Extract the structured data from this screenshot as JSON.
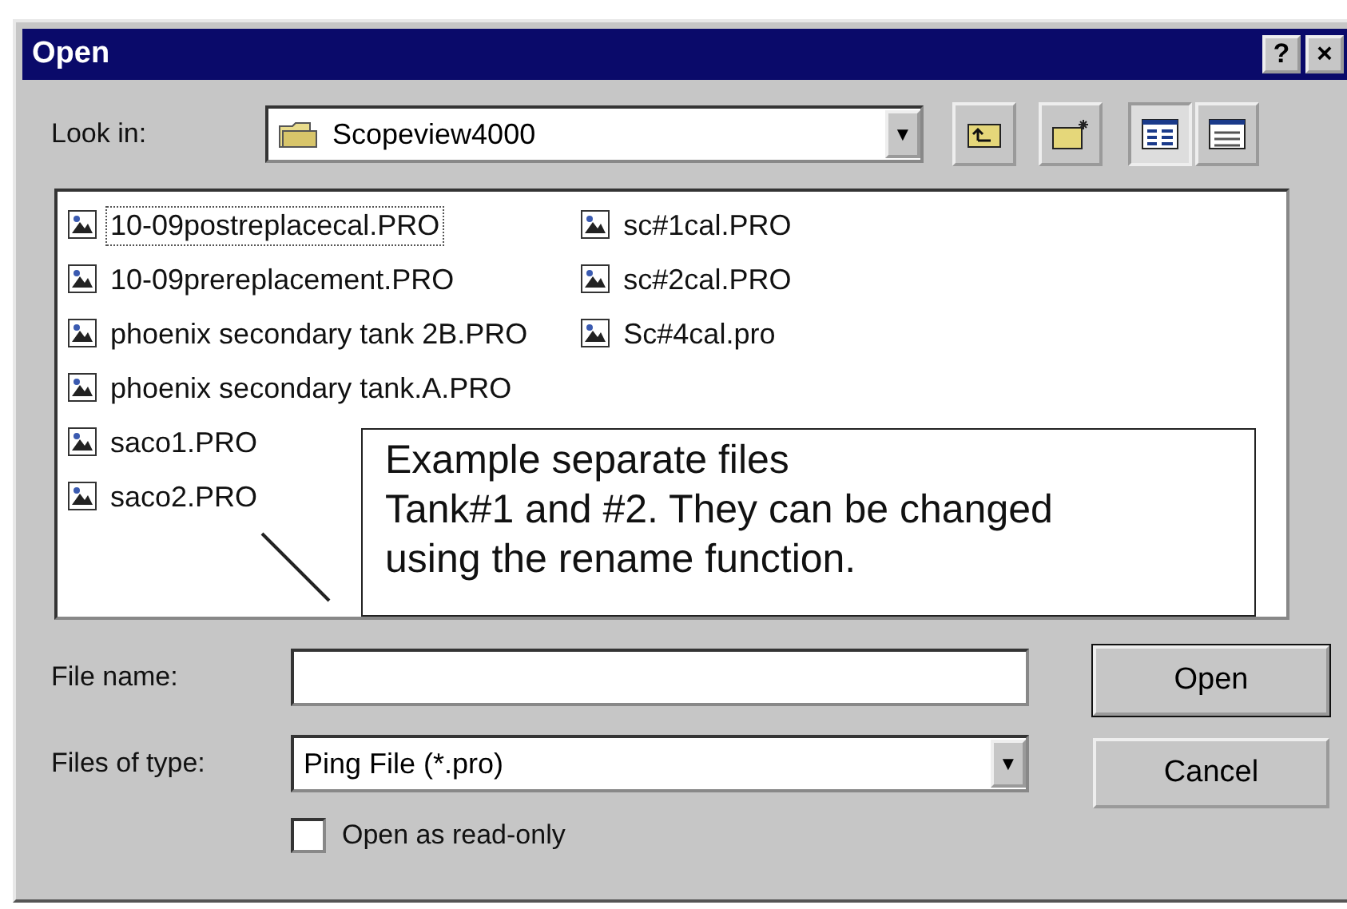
{
  "window": {
    "title": "Open",
    "title_buttons": [
      "?",
      "×"
    ]
  },
  "look_in": {
    "label": "Look in:",
    "value": "Scopeview4000",
    "arrow": "▼"
  },
  "toolbar": [
    {
      "kind": "up",
      "selected": false
    },
    {
      "kind": "newfolder",
      "selected": false
    },
    {
      "kind": "list",
      "selected": true
    },
    {
      "kind": "details",
      "selected": false
    }
  ],
  "files": [
    {
      "name": "10-09postreplacecal.PRO",
      "focused": true
    },
    {
      "name": "10-09prereplacement.PRO",
      "focused": false
    },
    {
      "name": "phoenix secondary tank 2B.PRO",
      "focused": false
    },
    {
      "name": "phoenix secondary tank.A.PRO",
      "focused": false
    },
    {
      "name": "saco1.PRO",
      "focused": false
    },
    {
      "name": "saco2.PRO",
      "focused": false
    },
    {
      "name": "sc#1cal.PRO",
      "focused": false
    },
    {
      "name": "sc#2cal.PRO",
      "focused": false
    },
    {
      "name": "Sc#4cal.pro",
      "focused": false
    }
  ],
  "callout": {
    "lines": [
      "Example separate files",
      "Tank#1 and #2. They can be changed",
      "using the rename function."
    ]
  },
  "file_name": {
    "label": "File name:"
  },
  "file_type": {
    "label": "Files of type:",
    "value": "Ping File (*.pro)",
    "arrow": "▼"
  },
  "read_only": {
    "label": "Open as read-only",
    "checked": false
  },
  "buttons": [
    "Open",
    "Cancel"
  ]
}
